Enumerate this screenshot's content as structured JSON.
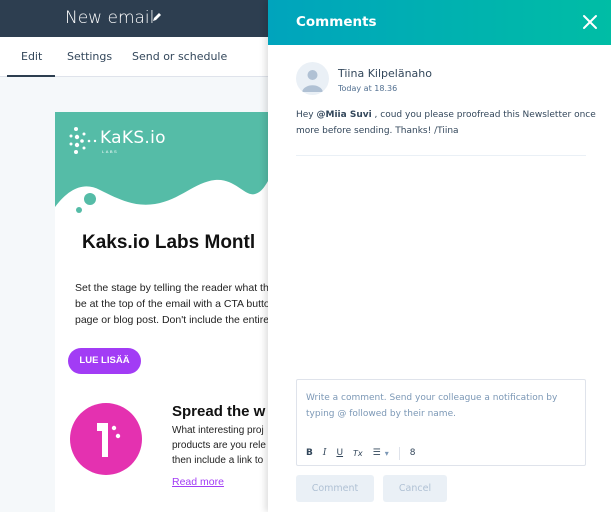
{
  "editor": {
    "title": "New email",
    "tabs": [
      {
        "label": "Edit",
        "active": true
      },
      {
        "label": "Settings",
        "active": false
      },
      {
        "label": "Send or schedule",
        "active": false
      }
    ],
    "email": {
      "logo_text": "KaKS.io",
      "logo_sub": "LABS",
      "heading": "Kaks.io Labs Montl",
      "intro_lines": [
        "Set the stage by telling the reader what the",
        "be at the top of the email with a CTA butto",
        "page or blog post. Don't include the entire"
      ],
      "cta_label": "LUE LISÄÄ",
      "section_heading": "Spread the w",
      "section_lines": [
        "What interesting proj",
        "products are you rele",
        "then include a link to"
      ],
      "read_more": "Read more",
      "colors": {
        "hero": "#55bca7",
        "cta": "#a23cf5",
        "badge": "#e431b0"
      }
    }
  },
  "comments_panel": {
    "title": "Comments",
    "comments": [
      {
        "author": "Tiina Kilpelänaho",
        "timestamp": "Today at 18.36",
        "text_prefix": "Hey ",
        "mention": "@Miia Suvi",
        "text_suffix": " , coud you please proofread this Newsletter once more before sending. Thanks! /Tiina"
      }
    ],
    "input": {
      "value": "",
      "placeholder": "Write a comment. Send your colleague a notification by typing @ followed by their name."
    },
    "toolbar": {
      "bold": "B",
      "italic": "I",
      "underline": "U",
      "clear_format": "Tx",
      "list": "☰",
      "dropdown": "▾",
      "link": "8"
    },
    "buttons": {
      "comment": "Comment",
      "cancel": "Cancel"
    },
    "colors": {
      "header_start": "#00a4bd",
      "header_end": "#00bda5"
    }
  }
}
